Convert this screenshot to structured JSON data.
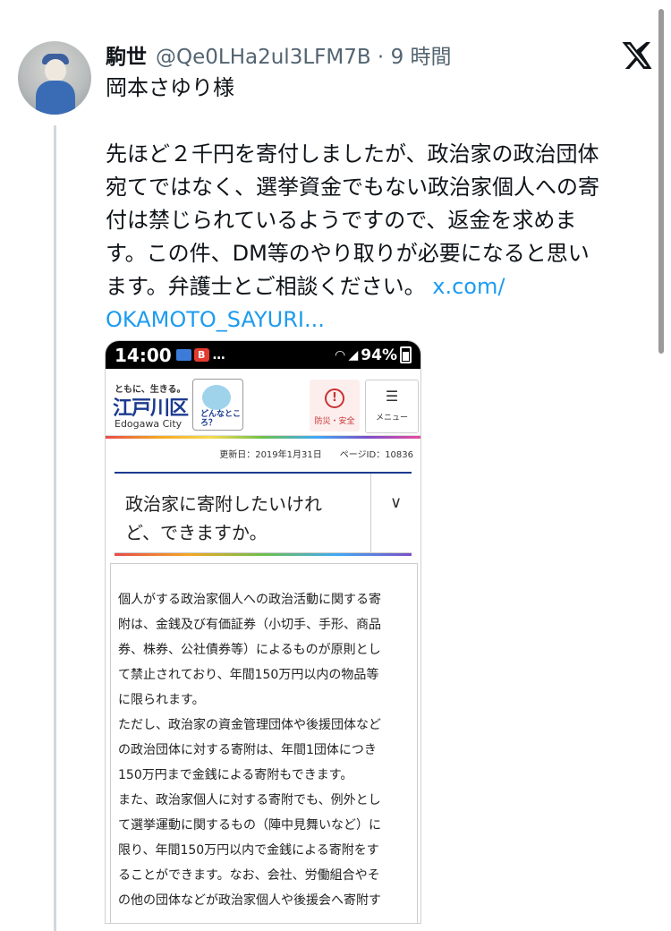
{
  "tweet": {
    "display_name": "駒世",
    "handle": "@Qe0LHa2ul3LFM7B",
    "time": "9 時間",
    "reply_to": "岡本さゆり様",
    "body_lines": [
      "先ほど２千円を寄付しましたが、政治家の政治団体",
      "宛てではなく、選挙資金でもない政治家個人への寄",
      "付は禁じられているようですので、返金を求めま",
      "す。この件、DM等のやり取りが必要になると思い",
      "ます。弁護士とご相談ください。 "
    ],
    "link_part1": "x.com/",
    "link_part2": "OKAMOTO_SAYURI...",
    "brand_icon": "x-logo-icon"
  },
  "embedded": {
    "status": {
      "time": "14:00",
      "dots": "…",
      "battery": "94%"
    },
    "site": {
      "tagline": "ともに、生きる。",
      "logo": "江戸川区",
      "logo_en": "Edogawa City",
      "mascot_label": "どんなところ？",
      "disaster_label": "防災・安全",
      "menu_label": "メニュー"
    },
    "meta": "更新日：2019年1月31日　　ページID：10836",
    "title_line1": "政治家に寄附したいけれ",
    "title_line2": "ど、できますか。",
    "paragraphs": [
      "個人がする政治家個人への政治活動に関する寄",
      "附は、金銭及び有価証券（小切手、手形、商品",
      "券、株券、公社債券等）によるものが原則とし",
      "て禁止されており、年間150万円以内の物品等",
      "に限られます。",
      "ただし、政治家の資金管理団体や後援団体など",
      "の政治団体に対する寄附は、年間1団体につき",
      "150万円まで金銭による寄附もできます。",
      "また、政治家個人に対する寄附でも、例外とし",
      "て選挙運動に関するもの（陣中見舞いなど）に",
      "限り、年間150万円以内で金銭による寄附をす",
      "ることができます。なお、会社、労働組合やそ",
      "の他の団体などが政治家個人や後援会へ寄附す"
    ]
  }
}
